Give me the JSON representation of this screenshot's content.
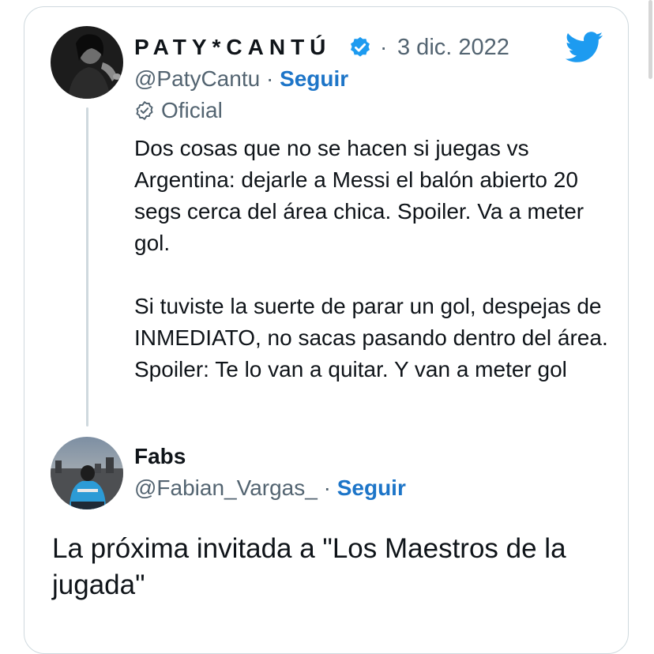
{
  "colors": {
    "accent": "#1d75c8",
    "secondary_text": "#536471",
    "twitter_blue": "#1d9bf0",
    "border": "#cfd9de"
  },
  "quoted_tweet": {
    "author_name": "PATY*CANTÚ",
    "verified_icon": "verified-badge-icon",
    "date": "3 dic. 2022",
    "handle": "@PatyCantu",
    "follow_label": "Seguir",
    "official_icon": "official-check-icon",
    "official_label": "Oficial",
    "paragraphs": [
      "Dos cosas que no se hacen si juegas vs Argentina: dejarle a Messi el balón abierto 20 segs cerca del área chica. Spoiler. Va a meter gol.",
      "Si tuviste la suerte de parar un gol, despejas de INMEDIATO, no sacas pasando dentro del área. Spoiler: Te lo van a quitar. Y van a meter gol"
    ]
  },
  "reply": {
    "author_name": "Fabs",
    "handle": "@Fabian_Vargas_",
    "follow_label": "Seguir",
    "text": "La próxima invitada a \"Los Maestros de la jugada\""
  },
  "separator": "·",
  "brand_icon": "twitter-bird-icon"
}
